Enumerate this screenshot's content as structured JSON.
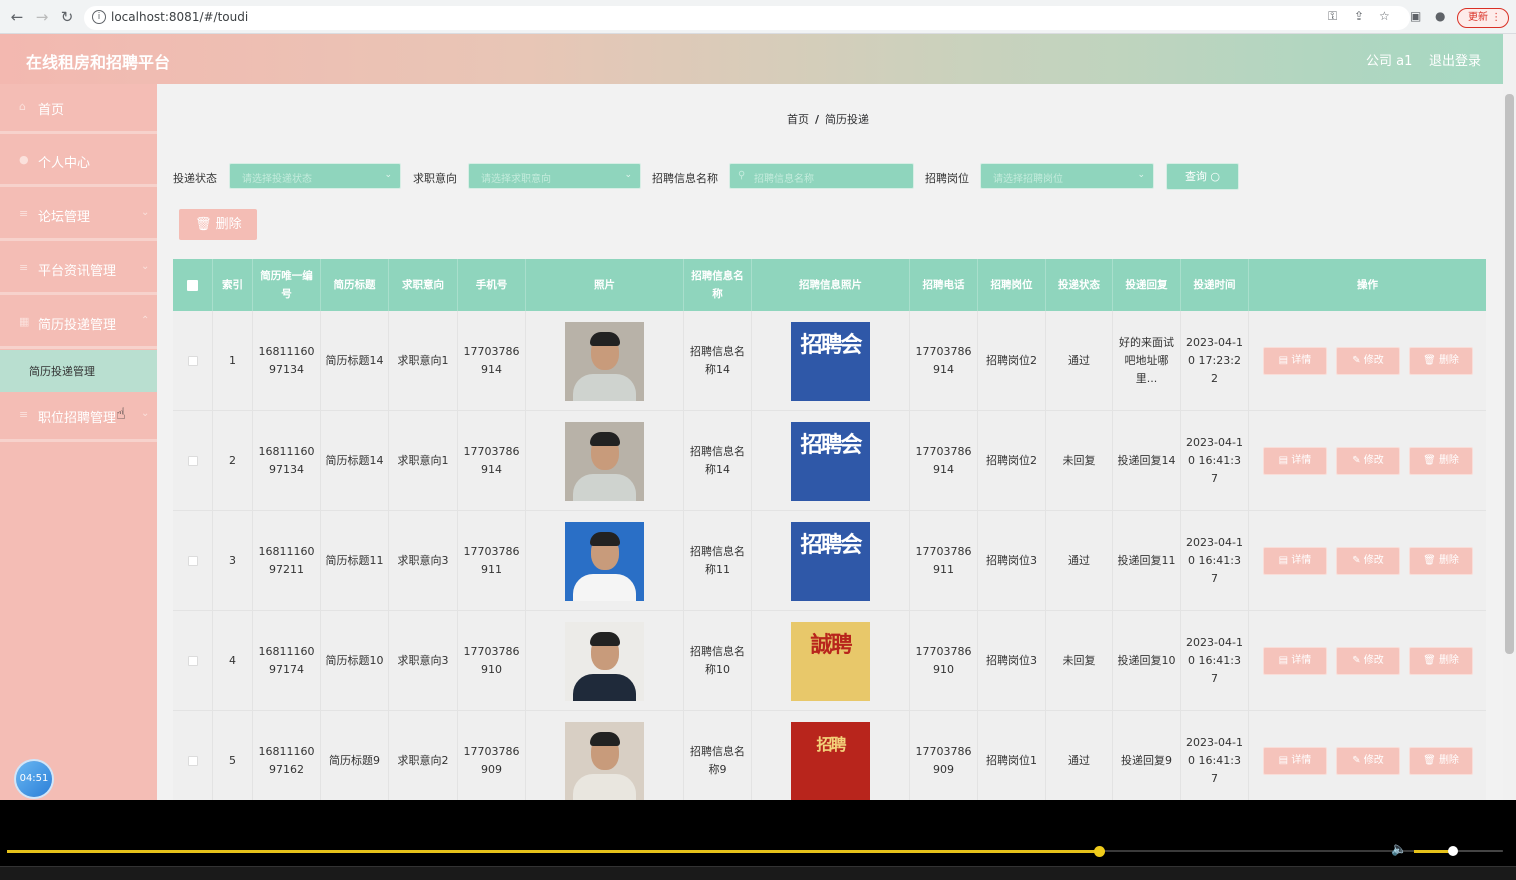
{
  "browser": {
    "url": "localhost:8081/#/toudi",
    "update_label": "更新"
  },
  "header": {
    "title": "在线租房和招聘平台",
    "user": "公司 a1",
    "logout": "退出登录"
  },
  "sidebar": {
    "items": [
      {
        "label": "首页",
        "icon": "home-icon"
      },
      {
        "label": "个人中心",
        "icon": "user-icon"
      },
      {
        "label": "论坛管理",
        "icon": "menu-icon"
      },
      {
        "label": "平台资讯管理",
        "icon": "menu-icon"
      },
      {
        "label": "简历投递管理",
        "icon": "grid-icon"
      },
      {
        "label": "职位招聘管理",
        "icon": "menu-icon"
      }
    ],
    "sub_item": "简历投递管理",
    "clock": "04:51"
  },
  "breadcrumb": {
    "home": "首页",
    "sep": "/",
    "current": "简历投递"
  },
  "filters": {
    "status_label": "投递状态",
    "status_placeholder": "请选择投递状态",
    "intent_label": "求职意向",
    "intent_placeholder": "请选择求职意向",
    "job_name_label": "招聘信息名称",
    "job_name_placeholder": "招聘信息名称",
    "position_label": "招聘岗位",
    "position_placeholder": "请选择招聘岗位",
    "query_label": "查询 ○",
    "delete_label": "删除"
  },
  "table": {
    "headers": [
      "",
      "索引",
      "简历唯一编号",
      "简历标题",
      "求职意向",
      "手机号",
      "照片",
      "招聘信息名称",
      "招聘信息照片",
      "招聘电话",
      "招聘岗位",
      "投递状态",
      "投递回复",
      "投递时间",
      "操作"
    ],
    "actions": {
      "detail": "详情",
      "edit": "修改",
      "delete": "删除"
    },
    "rows": [
      {
        "index": "1",
        "resume_id": "1681116097134",
        "resume_title": "简历标题14",
        "intent": "求职意向1",
        "phone": "17703786914",
        "job_name": "招聘信息名称14",
        "job_phone": "17703786914",
        "position": "招聘岗位2",
        "status": "通过",
        "reply": "好的来面试吧地址哪里...",
        "time": "2023-04-10 17:23:22"
      },
      {
        "index": "2",
        "resume_id": "1681116097134",
        "resume_title": "简历标题14",
        "intent": "求职意向1",
        "phone": "17703786914",
        "job_name": "招聘信息名称14",
        "job_phone": "17703786914",
        "position": "招聘岗位2",
        "status": "未回复",
        "reply": "投递回复14",
        "time": "2023-04-10 16:41:37"
      },
      {
        "index": "3",
        "resume_id": "1681116097211",
        "resume_title": "简历标题11",
        "intent": "求职意向3",
        "phone": "17703786911",
        "job_name": "招聘信息名称11",
        "job_phone": "17703786911",
        "position": "招聘岗位3",
        "status": "通过",
        "reply": "投递回复11",
        "time": "2023-04-10 16:41:37"
      },
      {
        "index": "4",
        "resume_id": "1681116097174",
        "resume_title": "简历标题10",
        "intent": "求职意向3",
        "phone": "17703786910",
        "job_name": "招聘信息名称10",
        "job_phone": "17703786910",
        "position": "招聘岗位3",
        "status": "未回复",
        "reply": "投递回复10",
        "time": "2023-04-10 16:41:37"
      },
      {
        "index": "5",
        "resume_id": "1681116097162",
        "resume_title": "简历标题9",
        "intent": "求职意向2",
        "phone": "17703786909",
        "job_name": "招聘信息名称9",
        "job_phone": "17703786909",
        "position": "招聘岗位1",
        "status": "通过",
        "reply": "投递回复9",
        "time": "2023-04-10 16:41:37"
      }
    ],
    "poster_texts": [
      "招聘会",
      "招聘会",
      "招聘会",
      "誠聘",
      "招聘"
    ]
  },
  "player": {
    "progress": 0.73,
    "volume": 0.44
  }
}
